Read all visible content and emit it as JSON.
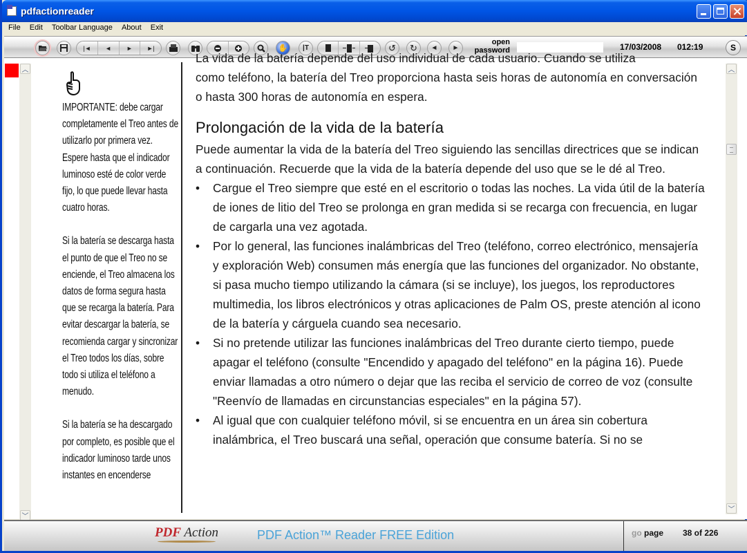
{
  "window": {
    "title": "pdfactionreader",
    "controls": {
      "minimize": "minimize",
      "maximize": "maximize",
      "close": "close"
    }
  },
  "menu": [
    "File",
    "Edit",
    "Toolbar Language",
    "About",
    "Exit"
  ],
  "toolbar": {
    "buttons": [
      {
        "name": "open-file",
        "icon": "folder-open-icon"
      },
      {
        "name": "save",
        "icon": "floppy-icon"
      },
      {
        "name": "first-page",
        "icon": "first-page-icon",
        "glyph": "|◄"
      },
      {
        "name": "previous-page",
        "icon": "previous-icon",
        "glyph": "◄"
      },
      {
        "name": "next-page",
        "icon": "next-icon",
        "glyph": "►"
      },
      {
        "name": "last-page",
        "icon": "last-page-icon",
        "glyph": "►|"
      },
      {
        "name": "print",
        "icon": "printer-icon"
      },
      {
        "name": "find",
        "icon": "binoculars-icon"
      },
      {
        "name": "zoom-out",
        "icon": "zoom-out-icon"
      },
      {
        "name": "zoom-in",
        "icon": "zoom-in-icon"
      },
      {
        "name": "zoom-tool",
        "icon": "magnifier-icon"
      },
      {
        "name": "web",
        "icon": "globe-icon"
      },
      {
        "name": "text-select",
        "icon": "text-cursor-icon"
      },
      {
        "name": "fit-page",
        "icon": "fit-page-icon"
      },
      {
        "name": "fit-width",
        "icon": "fit-width-icon"
      },
      {
        "name": "actual-size",
        "icon": "actual-size-icon"
      },
      {
        "name": "rotate-left",
        "icon": "rotate-left-icon"
      },
      {
        "name": "rotate-right",
        "icon": "rotate-right-icon"
      },
      {
        "name": "back",
        "icon": "back-icon"
      },
      {
        "name": "forward",
        "icon": "forward-icon"
      }
    ],
    "password_label_line1": "open",
    "password_label_line2": "password",
    "password_value": "",
    "date": "17/03/2008",
    "time": "012:19",
    "s_button": "S"
  },
  "sidebar_note": {
    "icon": "pointing-hand-icon",
    "paragraphs": [
      "IMPORTANTE: debe cargar completamente el Treo antes de utilizarlo por primera vez. Espere hasta que el indicador luminoso esté de color verde fijo, lo que puede llevar hasta cuatro horas.",
      "Si la batería se descarga hasta el punto de que el Treo no se enciende, el Treo almacena los datos de forma segura hasta que se recarga la batería. Para evitar descargar la batería, se recomienda cargar y sincronizar el Treo todos los días, sobre todo si utiliza el teléfono a menudo.",
      "Si la batería se ha descargado por completo, es posible que el indicador luminoso tarde unos instantes en encenderse"
    ]
  },
  "document": {
    "cut_line": "La vida de la batería depende del uso individual de cada usuario. Cuando se utiliza",
    "intro": "como teléfono, la batería del Treo proporciona hasta seis horas de autonomía en conversación o hasta 300 horas de autonomía en espera.",
    "heading": "Prolongación de la vida de la batería",
    "paragraph": "Puede aumentar la vida de la batería del Treo siguiendo las sencillas directrices que se indican a continuación. Recuerde que la vida de la batería depende del uso que se le dé al Treo.",
    "bullet_glyph": "•",
    "bullets": [
      "Cargue el Treo siempre que esté en el escritorio o todas las noches. La vida útil de la batería de iones de litio del Treo se prolonga en gran medida si se recarga con frecuencia, en lugar de cargarla una vez agotada.",
      "Por lo general, las funciones inalámbricas del Treo (teléfono, correo electrónico, mensajería y exploración Web) consumen más energía que las funciones del organizador. No obstante, si pasa mucho tiempo utilizando la cámara (si se incluye), los juegos, los reproductores multimedia, los libros electrónicos y otras aplicaciones de Palm OS, preste atención al icono de la batería y cárguela cuando sea necesario.",
      "Si no pretende utilizar las funciones inalámbricas del Treo durante cierto tiempo, puede apagar el teléfono (consulte \"Encendido y apagado del teléfono\" en la página 16). Puede enviar llamadas a otro número o dejar que las reciba el servicio de correo de voz (consulte \"Reenvío de llamadas en circunstancias especiales\" en la página 57).",
      "Al igual que con cualquier teléfono móvil, si se encuentra en un área sin cobertura inalámbrica, el Treo buscará una señal, operación que consume batería. Si no se"
    ]
  },
  "statusbar": {
    "logo_pdf": "PDF",
    "logo_action": "Action",
    "edition": "PDF Action™ Reader FREE Edition",
    "go_label": "go",
    "page_label": "page",
    "page_indicator": "38 of 226",
    "current_page": 38,
    "total_pages": 226
  },
  "colors": {
    "titlebar": "#0055e5",
    "marker": "#ff0000",
    "edition_text": "#4aa3d8",
    "logo_red": "#c0272d"
  }
}
